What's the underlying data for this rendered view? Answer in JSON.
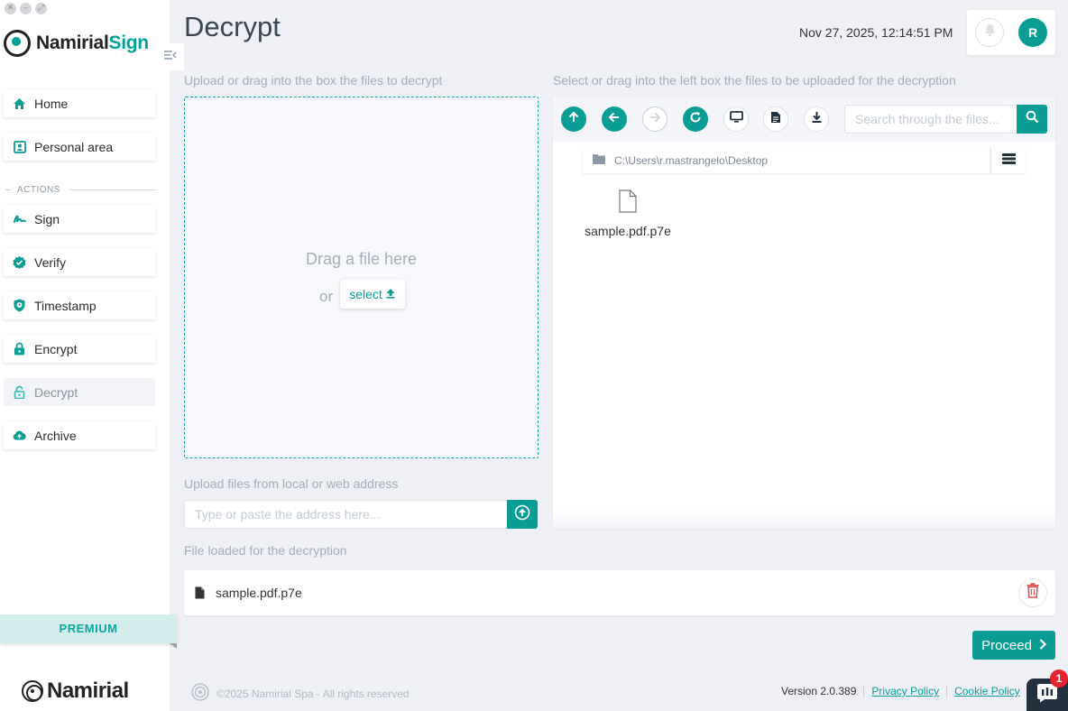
{
  "window": {
    "controls": [
      "✕",
      "–",
      "⤢"
    ]
  },
  "brand": {
    "name_primary": "Namirial",
    "name_accent": "Sign",
    "footer_name": "Namirial"
  },
  "sidebar": {
    "items": [
      {
        "label": "Home",
        "icon": "home-icon"
      },
      {
        "label": "Personal area",
        "icon": "id-card-icon"
      }
    ],
    "section_label": "ACTIONS",
    "actions": [
      {
        "label": "Sign",
        "icon": "signature-icon"
      },
      {
        "label": "Verify",
        "icon": "check-badge-icon"
      },
      {
        "label": "Timestamp",
        "icon": "shield-clock-icon"
      },
      {
        "label": "Encrypt",
        "icon": "lock-icon"
      },
      {
        "label": "Decrypt",
        "icon": "unlock-icon",
        "active": true
      },
      {
        "label": "Archive",
        "icon": "cloud-upload-icon"
      }
    ],
    "premium_label": "PREMIUM"
  },
  "header": {
    "title": "Decrypt",
    "datetime": "Nov 27, 2025, 12:14:51 PM",
    "avatar_initial": "R"
  },
  "upload": {
    "label": "Upload or drag into the box the files to decrypt",
    "drop_text": "Drag a file here",
    "or_text": "or",
    "select_label": "select"
  },
  "url_upload": {
    "label": "Upload files from local or web address",
    "placeholder": "Type or paste the address here..."
  },
  "browser": {
    "label": "Select or drag into the left box the files to be uploaded for the decryption",
    "search_placeholder": "Search through the files...",
    "path": "C:\\Users\\r.mastrangelo\\Desktop",
    "files": [
      {
        "name": "sample.pdf.p7e"
      }
    ]
  },
  "loaded": {
    "label": "File loaded for the decryption",
    "file_name": "sample.pdf.p7e"
  },
  "actions": {
    "proceed_label": "Proceed"
  },
  "footer": {
    "copyright": "©2025 Namirial Spa - All rights reserved",
    "version": "Version 2.0.389",
    "privacy": "Privacy Policy",
    "cookie": "Cookie Policy",
    "chat_badge": "1"
  },
  "colors": {
    "accent": "#0a9d96",
    "danger": "#e05252",
    "badge": "#e3232d"
  }
}
